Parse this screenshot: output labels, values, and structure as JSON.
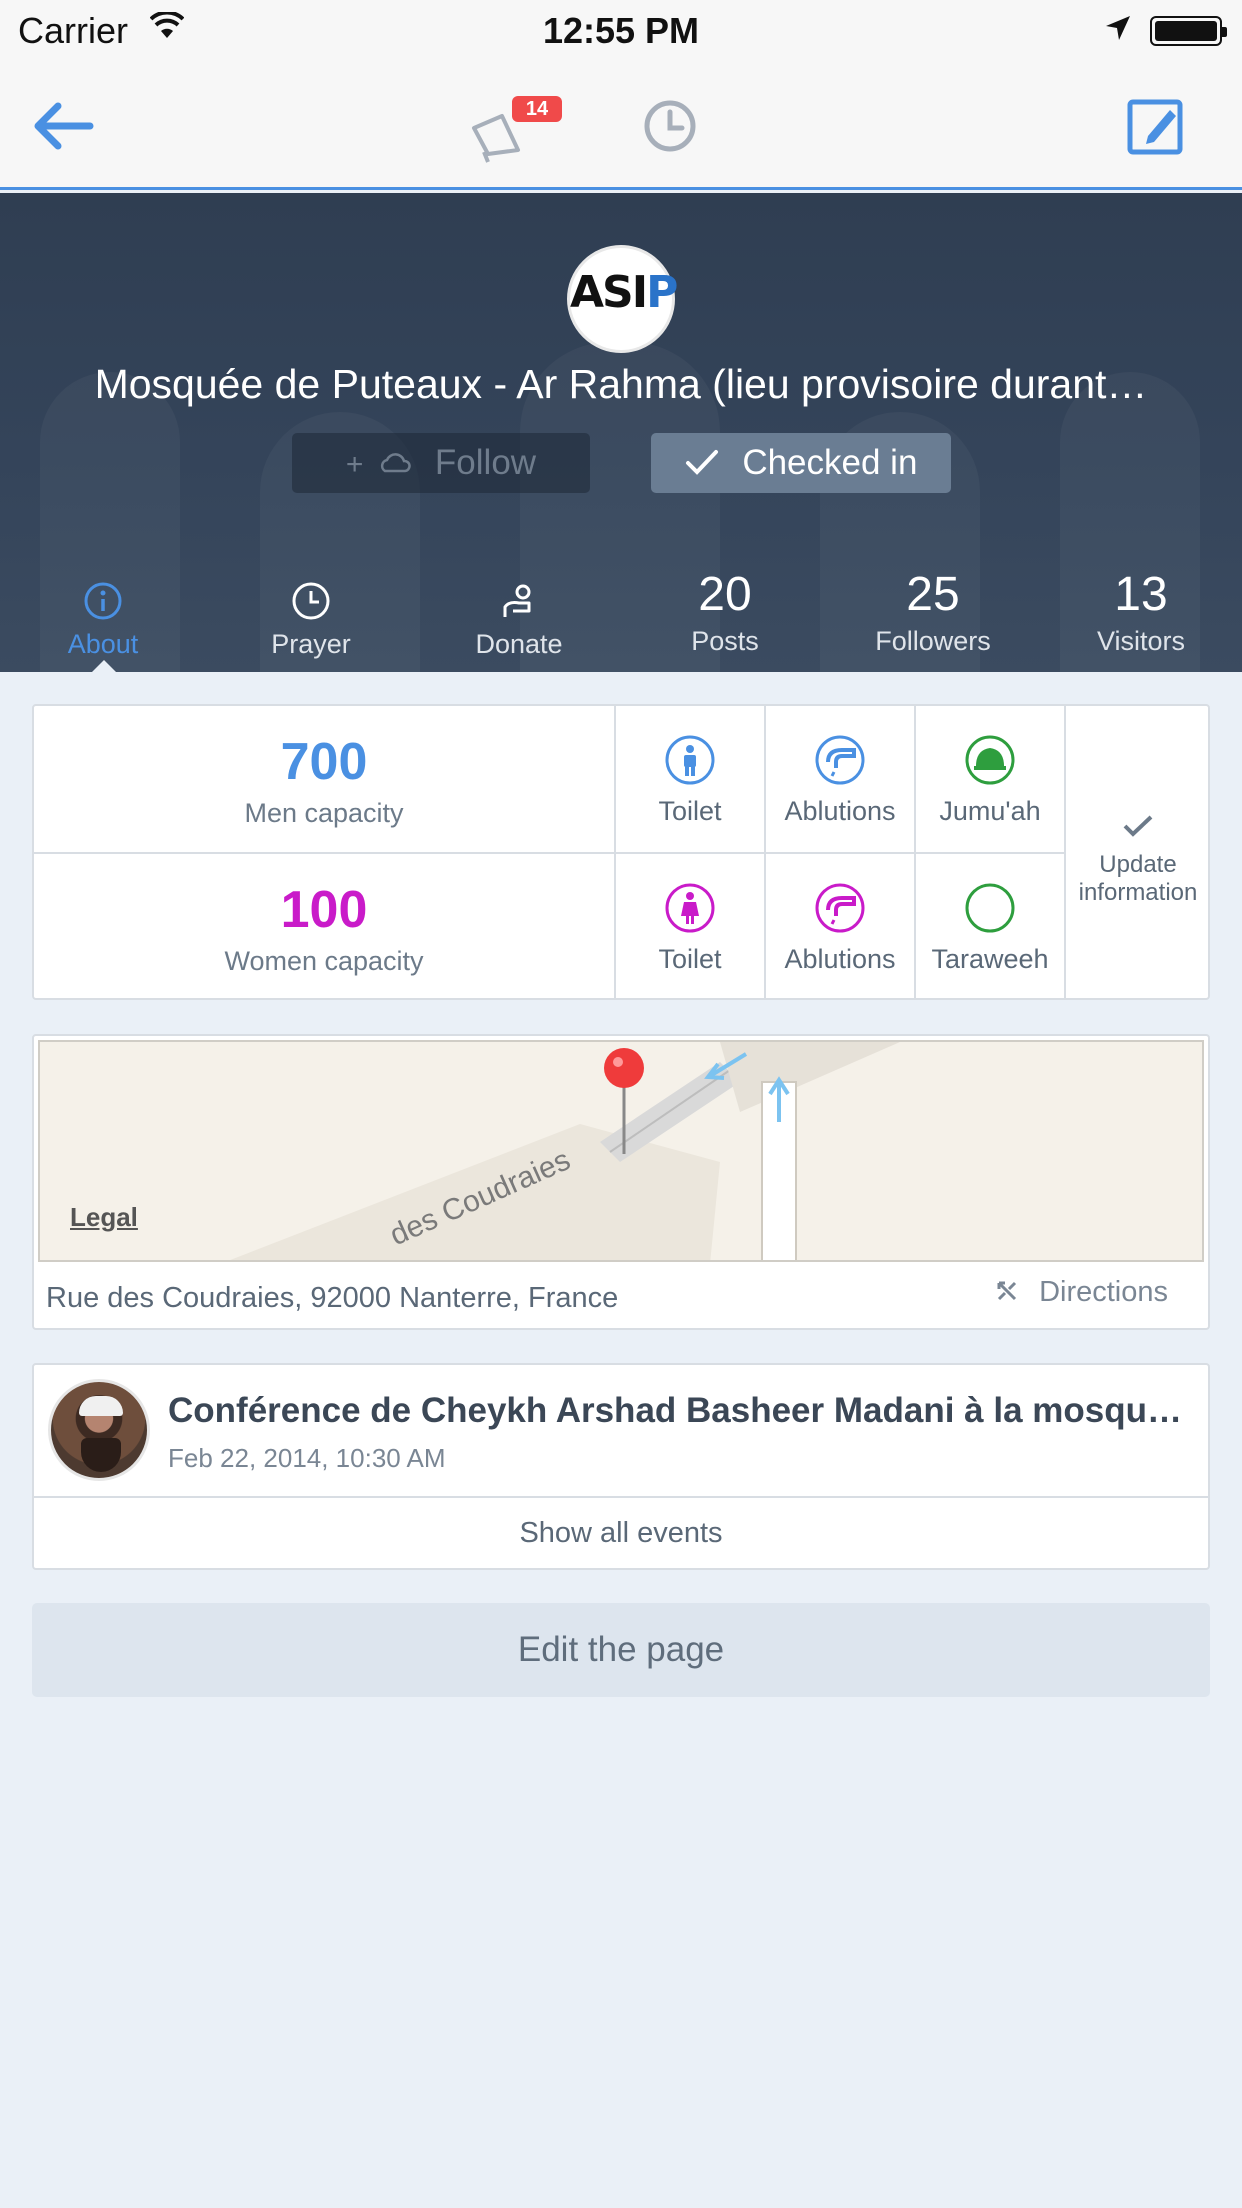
{
  "status_bar": {
    "carrier": "Carrier",
    "time": "12:55 PM"
  },
  "nav": {
    "notification_count": "14"
  },
  "place": {
    "title": "Mosquée de Puteaux - Ar Rahma (lieu provisoire durant…",
    "logo_text": "ASIP",
    "follow_label": "Follow",
    "checked_in_label": "Checked in"
  },
  "tabs": [
    {
      "label": "About",
      "icon": "info-icon",
      "active": true
    },
    {
      "label": "Prayer",
      "icon": "clock-icon"
    },
    {
      "label": "Donate",
      "icon": "donate-icon"
    }
  ],
  "stats": [
    {
      "value": "20",
      "label": "Posts"
    },
    {
      "value": "25",
      "label": "Followers"
    },
    {
      "value": "13",
      "label": "Visitors"
    }
  ],
  "facilities": {
    "men": {
      "capacity": "700",
      "label": "Men capacity",
      "color": "#4a90e2"
    },
    "women": {
      "capacity": "100",
      "label": "Women capacity",
      "color": "#c91bc9"
    },
    "men_row": [
      {
        "label": "Toilet",
        "icon": "men-toilet-icon"
      },
      {
        "label": "Ablutions",
        "icon": "men-ablutions-icon"
      },
      {
        "label": "Jumu'ah",
        "icon": "jumuah-mosque-icon"
      }
    ],
    "women_row": [
      {
        "label": "Toilet",
        "icon": "women-toilet-icon"
      },
      {
        "label": "Ablutions",
        "icon": "women-ablutions-icon"
      },
      {
        "label": "Taraweeh",
        "icon": "crescent-icon"
      }
    ],
    "update": {
      "line1": "Update",
      "line2": "information"
    }
  },
  "map": {
    "legal": "Legal",
    "street": "des Coudraies",
    "address": "Rue des Coudraies, 92000 Nanterre, France",
    "directions": "Directions"
  },
  "events": {
    "items": [
      {
        "title": "Conférence de Cheykh Arshad Basheer Madani à la mosqu…",
        "date": "Feb 22, 2014, 10:30 AM"
      }
    ],
    "show_all": "Show all events"
  },
  "edit_page": "Edit the page",
  "colors": {
    "accent": "#4a90e2",
    "women": "#c91bc9",
    "green": "#2e9e3e",
    "badge": "#f04a4a"
  }
}
